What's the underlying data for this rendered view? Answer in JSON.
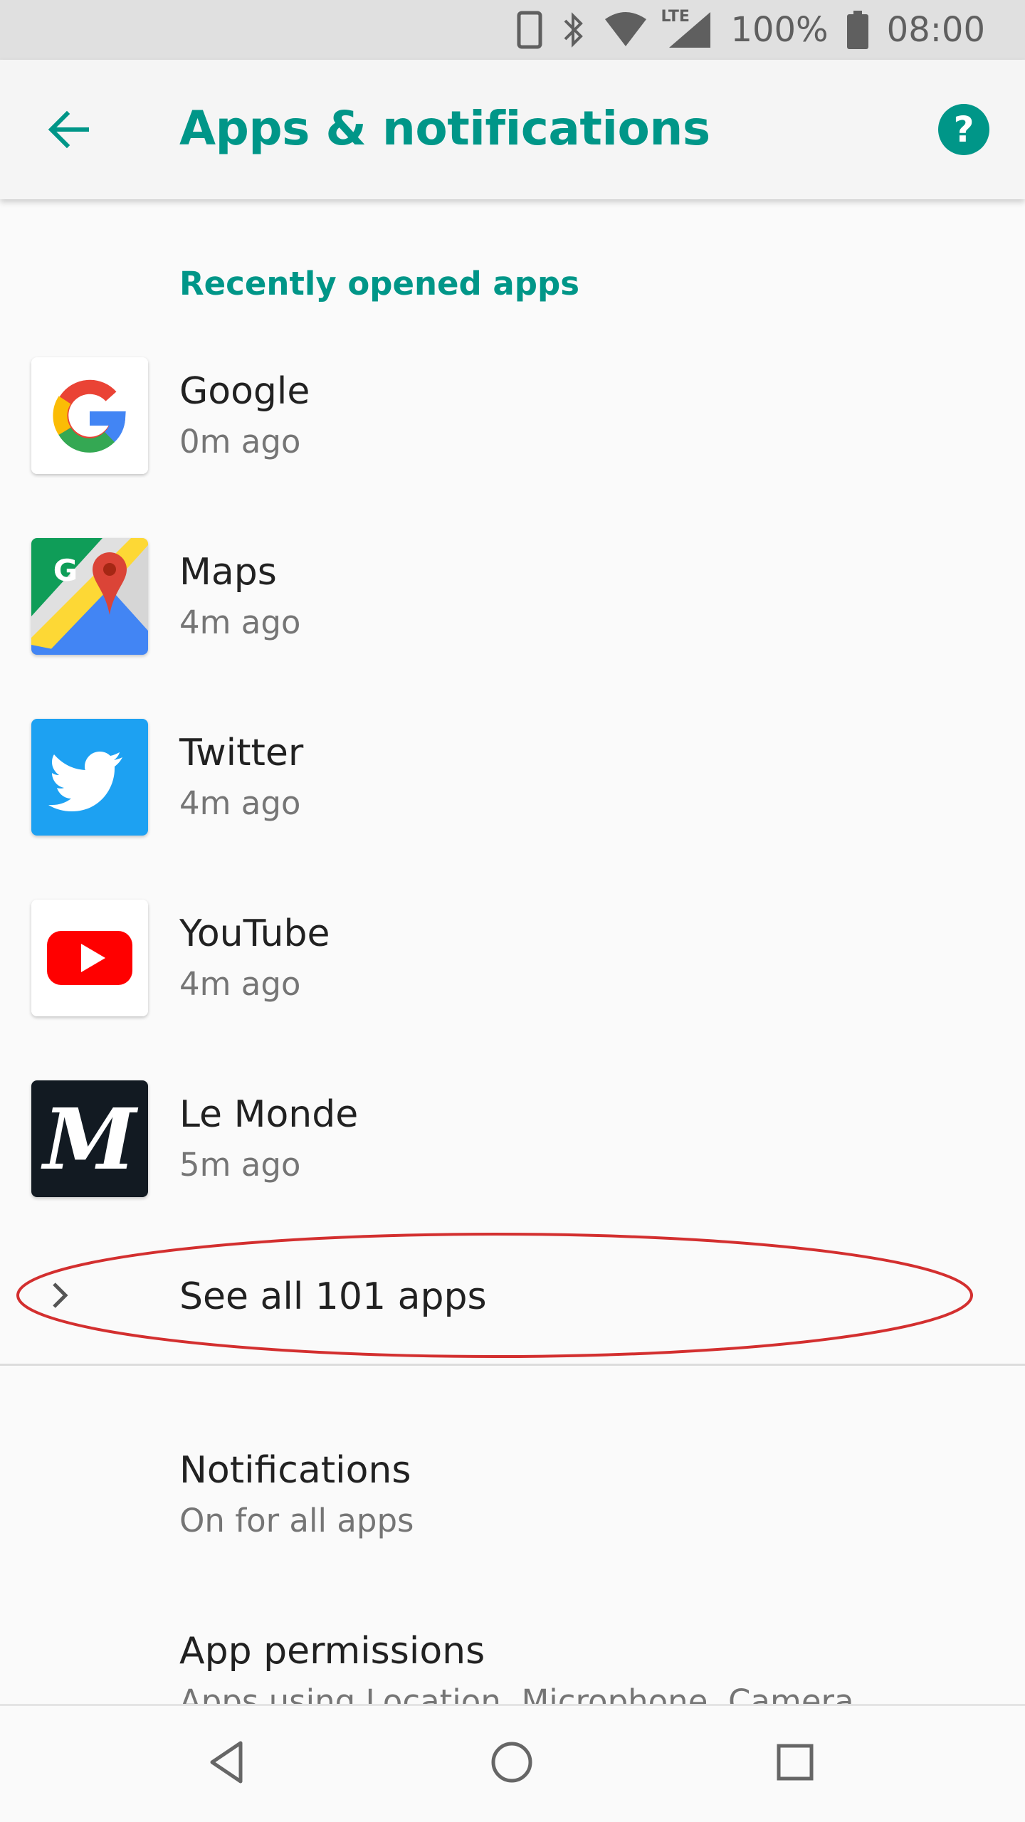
{
  "status_bar": {
    "battery_text": "100%",
    "time": "08:00",
    "network_label": "LTE"
  },
  "app_bar": {
    "title": "Apps & notifications",
    "back_icon": "arrow-left-icon",
    "help_icon": "help-circle-icon",
    "accent_color": "#009688"
  },
  "recent": {
    "header": "Recently opened apps",
    "apps": [
      {
        "name": "Google",
        "time": "0m ago",
        "icon": "google-icon"
      },
      {
        "name": "Maps",
        "time": "4m ago",
        "icon": "maps-icon"
      },
      {
        "name": "Twitter",
        "time": "4m ago",
        "icon": "twitter-icon"
      },
      {
        "name": "YouTube",
        "time": "4m ago",
        "icon": "youtube-icon"
      },
      {
        "name": "Le Monde",
        "time": "5m ago",
        "icon": "le-monde-icon"
      }
    ]
  },
  "see_all": {
    "label": "See all 101 apps",
    "annotation_color": "#d32f2f"
  },
  "settings": [
    {
      "title": "Notifications",
      "subtitle": "On for all apps"
    },
    {
      "title": "App permissions",
      "subtitle": "Apps using Location, Microphone, Camera"
    }
  ],
  "nav_bar": {
    "back_icon": "nav-back-icon",
    "home_icon": "nav-home-icon",
    "recents_icon": "nav-recents-icon"
  }
}
